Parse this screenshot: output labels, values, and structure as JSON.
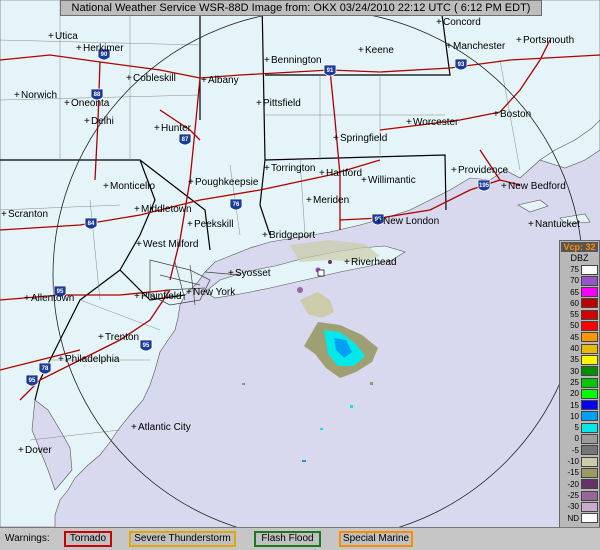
{
  "header": {
    "text": "National Weather Service WSR-88D Image from: OKX 03/24/2010 22:12 UTC ( 6:12 PM EDT)"
  },
  "legend": {
    "vcp_label": "Vcp: 32",
    "unit": "DBZ",
    "levels": [
      {
        "label": "75",
        "color": "#ffffff"
      },
      {
        "label": "70",
        "color": "#9854c6"
      },
      {
        "label": "65",
        "color": "#f800fd"
      },
      {
        "label": "60",
        "color": "#bc0000"
      },
      {
        "label": "55",
        "color": "#d40000"
      },
      {
        "label": "50",
        "color": "#fd0000"
      },
      {
        "label": "45",
        "color": "#fd9500"
      },
      {
        "label": "40",
        "color": "#e5bc00"
      },
      {
        "label": "35",
        "color": "#fdf802"
      },
      {
        "label": "30",
        "color": "#008e00"
      },
      {
        "label": "25",
        "color": "#01c801"
      },
      {
        "label": "20",
        "color": "#02fd02"
      },
      {
        "label": "15",
        "color": "#0300f4"
      },
      {
        "label": "10",
        "color": "#019ff4"
      },
      {
        "label": "5",
        "color": "#04e9e7"
      },
      {
        "label": "0",
        "color": "#9c9c9c"
      },
      {
        "label": "-5",
        "color": "#767676"
      },
      {
        "label": "-10",
        "color": "#ccccaa"
      },
      {
        "label": "-15",
        "color": "#999966"
      },
      {
        "label": "-20",
        "color": "#663366"
      },
      {
        "label": "-25",
        "color": "#996699"
      },
      {
        "label": "-30",
        "color": "#ccaacc"
      },
      {
        "label": "ND",
        "color": "#ffffff"
      }
    ]
  },
  "warnings": {
    "label": "Warnings:",
    "items": [
      {
        "label": "Tornado",
        "color": "#cc0000"
      },
      {
        "label": "Severe Thunderstorm",
        "color": "#e0a800"
      },
      {
        "label": "Flash Flood",
        "color": "#1a7a1a"
      },
      {
        "label": "Special Marine",
        "color": "#ff8c00"
      }
    ]
  },
  "map": {
    "land_color": "#e4f4f8",
    "water_color": "#d8d8ee",
    "cities": [
      {
        "name": "Utica"
      },
      {
        "name": "Herkimer"
      },
      {
        "name": "Norwich"
      },
      {
        "name": "Cobleskill"
      },
      {
        "name": "Albany"
      },
      {
        "name": "Oneonta"
      },
      {
        "name": "Delhi"
      },
      {
        "name": "Hunter"
      },
      {
        "name": "Bennington"
      },
      {
        "name": "Keene"
      },
      {
        "name": "Concord"
      },
      {
        "name": "Manchester"
      },
      {
        "name": "Portsmouth"
      },
      {
        "name": "Pittsfield"
      },
      {
        "name": "Springfield"
      },
      {
        "name": "Worcester"
      },
      {
        "name": "Boston"
      },
      {
        "name": "Monticello"
      },
      {
        "name": "Poughkeepsie"
      },
      {
        "name": "Torrington"
      },
      {
        "name": "Hartford"
      },
      {
        "name": "Willimantic"
      },
      {
        "name": "Providence"
      },
      {
        "name": "New Bedford"
      },
      {
        "name": "Scranton"
      },
      {
        "name": "Middletown"
      },
      {
        "name": "Meriden"
      },
      {
        "name": "New London"
      },
      {
        "name": "Nantucket"
      },
      {
        "name": "Peekskill"
      },
      {
        "name": "Bridgeport"
      },
      {
        "name": "West Milford"
      },
      {
        "name": "Riverhead"
      },
      {
        "name": "Syosset"
      },
      {
        "name": "Allentown"
      },
      {
        "name": "Plainfield"
      },
      {
        "name": "New York"
      },
      {
        "name": "Trenton"
      },
      {
        "name": "Philadelphia"
      },
      {
        "name": "Atlantic City"
      },
      {
        "name": "Dover"
      }
    ],
    "shields": [
      {
        "label": "90"
      },
      {
        "label": "88"
      },
      {
        "label": "87"
      },
      {
        "label": "91"
      },
      {
        "label": "93"
      },
      {
        "label": "84"
      },
      {
        "label": "95"
      },
      {
        "label": "95"
      },
      {
        "label": "95"
      },
      {
        "label": "78"
      },
      {
        "label": "195"
      },
      {
        "label": "76"
      },
      {
        "label": "95"
      }
    ]
  }
}
